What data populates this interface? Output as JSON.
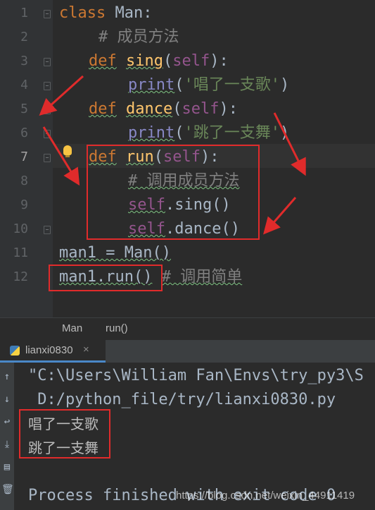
{
  "editor": {
    "line_numbers": [
      "1",
      "2",
      "3",
      "4",
      "5",
      "6",
      "7",
      "8",
      "9",
      "10",
      "11",
      "12"
    ],
    "active_line": "7",
    "lines": {
      "l1": {
        "kw": "class",
        "name": " Man:"
      },
      "l2": {
        "comment": "# 成员方法"
      },
      "l3": {
        "kw": "def",
        "fn": "sing",
        "open": "(",
        "self": "self",
        "close": "):"
      },
      "l4": {
        "fn": "print",
        "open": "(",
        "str": "'唱了一支歌'",
        "close": ")"
      },
      "l5": {
        "kw": "def",
        "fn": "dance",
        "open": "(",
        "self": "self",
        "close": "):"
      },
      "l6": {
        "fn": "print",
        "open": "(",
        "str": "'跳了一支舞'",
        "close": ")"
      },
      "l7": {
        "kw": "def",
        "fn": "run",
        "open": "(",
        "self": "self",
        "close": "):"
      },
      "l8": {
        "comment": "# 调用成员方法"
      },
      "l9": {
        "self": "self",
        "rest": ".sing()"
      },
      "l10": {
        "self": "self",
        "rest": ".dance()"
      },
      "l11": {
        "text": "man1 = Man()"
      },
      "l12": {
        "text": "man1.run()",
        "comment": "# 调用简单"
      }
    }
  },
  "breadcrumb": {
    "class_name": "Man",
    "method_name": "run()"
  },
  "run_panel": {
    "tab_label": "lianxi0830",
    "tab_close": "×",
    "console_lines": {
      "c1": "\"C:\\Users\\William Fan\\Envs\\try_py3\\S",
      "c2": " D:/python_file/try/lianxi0830.py",
      "c3": "唱了一支歌",
      "c4": "跳了一支舞",
      "c5": "Process finished with exit code 0"
    }
  },
  "watermark": "https://blog.csdn.net/weixin_44911419",
  "colors": {
    "annotation_red": "#e02b2b",
    "keyword": "#cc7832",
    "function": "#ffc66d",
    "self": "#94558d",
    "string": "#6a8759",
    "comment": "#808080"
  }
}
